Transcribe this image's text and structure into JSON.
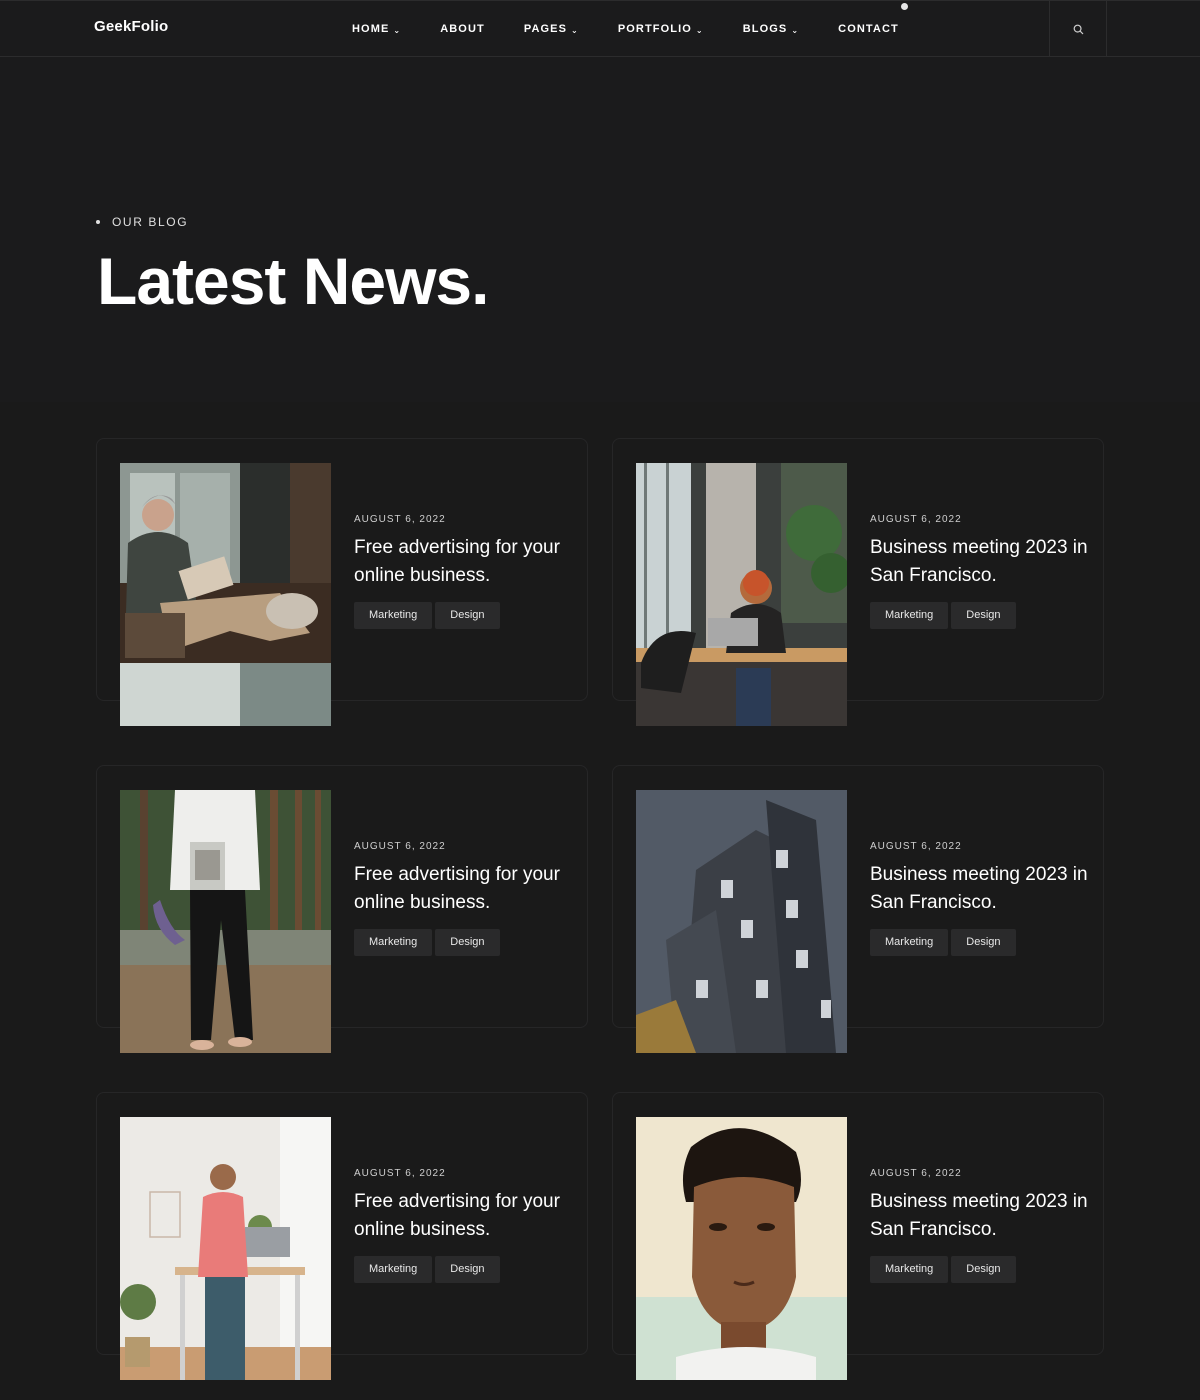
{
  "header": {
    "logo": "GeekFolio",
    "nav": [
      {
        "label": "HOME",
        "dropdown": true
      },
      {
        "label": "ABOUT",
        "dropdown": false
      },
      {
        "label": "PAGES",
        "dropdown": true
      },
      {
        "label": "PORTFOLIO",
        "dropdown": true
      },
      {
        "label": "BLOGS",
        "dropdown": true
      },
      {
        "label": "CONTACT",
        "dropdown": false
      }
    ],
    "caret": "⌄",
    "search_icon": "search-icon"
  },
  "hero": {
    "eyebrow": "OUR BLOG",
    "title": "Latest News."
  },
  "posts": [
    {
      "date": "AUGUST 6, 2022",
      "title": "Free advertising for your online business.",
      "tags": [
        "Marketing",
        "Design"
      ],
      "image": "man-reading-laptop-on-couch"
    },
    {
      "date": "AUGUST 6, 2022",
      "title": "Business meeting 2023 in San Francisco.",
      "tags": [
        "Marketing",
        "Design"
      ],
      "image": "woman-working-laptop-office"
    },
    {
      "date": "AUGUST 6, 2022",
      "title": "Free advertising for your online business.",
      "tags": [
        "Marketing",
        "Design"
      ],
      "image": "person-holding-magazine-outdoors"
    },
    {
      "date": "AUGUST 6, 2022",
      "title": "Business meeting 2023 in San Francisco.",
      "tags": [
        "Marketing",
        "Design"
      ],
      "image": "modern-building-facade"
    },
    {
      "date": "AUGUST 6, 2022",
      "title": "Free advertising for your online business.",
      "tags": [
        "Marketing",
        "Design"
      ],
      "image": "man-on-phone-standing-desk"
    },
    {
      "date": "AUGUST 6, 2022",
      "title": "Business meeting 2023 in San Francisco.",
      "tags": [
        "Marketing",
        "Design"
      ],
      "image": "young-man-portrait"
    }
  ],
  "colors": {
    "background": "#1b1b1c",
    "card_border": "#262627",
    "tag_background": "#2a2a2b",
    "text": "#ffffff"
  }
}
